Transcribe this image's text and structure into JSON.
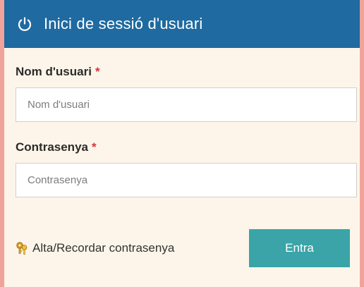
{
  "header": {
    "title": "Inici de sessió d'usuari",
    "icon": "power-icon",
    "background": "#1f6aa0"
  },
  "form": {
    "username": {
      "label": "Nom d'usuari",
      "required_mark": "*",
      "placeholder": "Nom d'usuari",
      "value": ""
    },
    "password": {
      "label": "Contrasenya",
      "required_mark": "*",
      "placeholder": "Contrasenya",
      "value": ""
    }
  },
  "footer": {
    "link_label": "Alta/Recordar contrasenya",
    "link_icon": "keys-icon",
    "submit_label": "Entra",
    "submit_color": "#3aa4a8"
  }
}
